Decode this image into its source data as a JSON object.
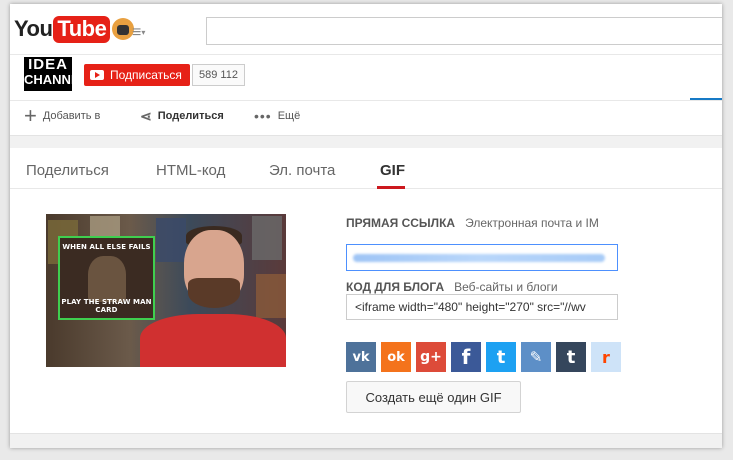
{
  "masthead": {
    "logo_you": "You",
    "logo_tube": "Tube",
    "guide_icon": "hamburger-menu-icon",
    "search_value": ""
  },
  "channel": {
    "avatar_line1": "IDEA",
    "avatar_line2": "CHANNEL",
    "subscribe_label": "Подписаться",
    "subscriber_count": "589 112"
  },
  "actions": {
    "add_to": "Добавить в",
    "share": "Поделиться",
    "more": "Ещё"
  },
  "share_tabs": [
    {
      "label": "Поделиться"
    },
    {
      "label": "HTML-код"
    },
    {
      "label": "Эл. почта"
    },
    {
      "label": "GIF"
    }
  ],
  "preview": {
    "meme_top": "WHEN ALL ELSE FAILS",
    "meme_bottom": "PLAY THE STRAW MAN CARD"
  },
  "direct_link": {
    "label": "ПРЯМАЯ ССЫЛКА",
    "hint": "Электронная почта и IM",
    "value": ""
  },
  "blog_code": {
    "label": "КОД ДЛЯ БЛОГА",
    "hint": "Веб-сайты и блоги",
    "value": "<iframe width=\"480\" height=\"270\" src=\"//wv"
  },
  "share_services": [
    {
      "name": "vk",
      "glyph": "vk",
      "color": "#4e729a"
    },
    {
      "name": "odnoklassniki",
      "glyph": "ok",
      "color": "#f4731c"
    },
    {
      "name": "google-plus",
      "glyph": "g+",
      "color": "#dd4b39"
    },
    {
      "name": "facebook",
      "glyph": "f",
      "color": "#3b5998"
    },
    {
      "name": "twitter",
      "glyph": "t",
      "color": "#1da1f2"
    },
    {
      "name": "livejournal",
      "glyph": "✎",
      "color": "#5d8fc7"
    },
    {
      "name": "tumblr",
      "glyph": "t",
      "color": "#35465c"
    },
    {
      "name": "reddit",
      "glyph": "r",
      "color": "#cee3f8"
    }
  ],
  "create_gif_label": "Создать ещё один GIF"
}
